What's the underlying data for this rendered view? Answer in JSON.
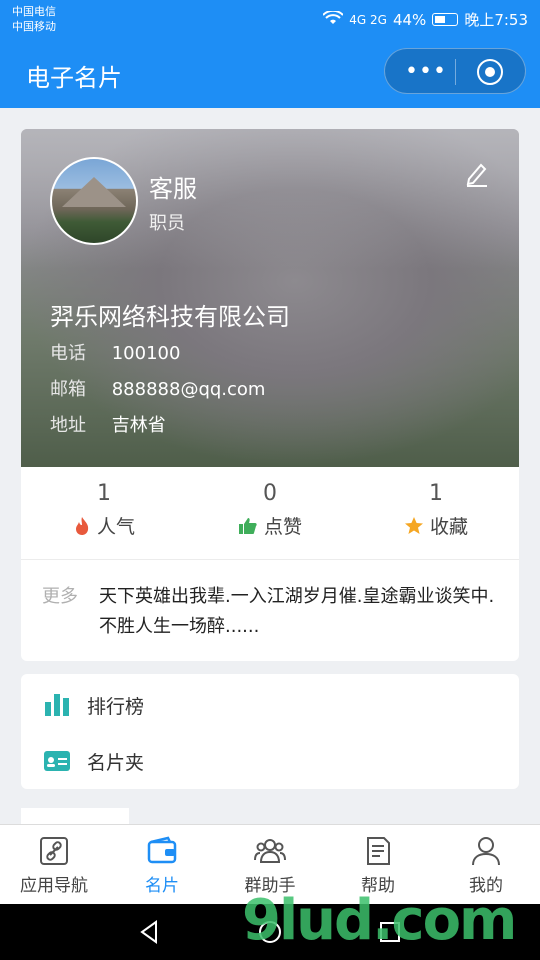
{
  "status": {
    "carrier1": "中国电信",
    "carrier2": "中国移动",
    "signal": "4G 2G",
    "battery": "44%",
    "time": "晚上7:53"
  },
  "nav": {
    "title": "电子名片",
    "more": "•••"
  },
  "profile": {
    "name": "客服",
    "position": "职员",
    "company": "羿乐网络科技有限公司",
    "phone_label": "电话",
    "phone": "100100",
    "email_label": "邮箱",
    "email": "888888@qq.com",
    "address_label": "地址",
    "address": "吉林省"
  },
  "stats": [
    {
      "value": "1",
      "label": "人气",
      "icon": "fire-icon",
      "color": "#e8593c"
    },
    {
      "value": "0",
      "label": "点赞",
      "icon": "thumbs-up-icon",
      "color": "#3fae5a"
    },
    {
      "value": "1",
      "label": "收藏",
      "icon": "star-icon",
      "color": "#f5a623"
    }
  ],
  "more": {
    "label": "更多",
    "text": "天下英雄出我辈.一入江湖岁月催.皇途霸业谈笑中.不胜人生一场醉......"
  },
  "menu": [
    {
      "label": "排行榜",
      "icon": "bar-chart-icon"
    },
    {
      "label": "名片夹",
      "icon": "card-holder-icon"
    }
  ],
  "tabs": [
    {
      "label": "应用导航",
      "icon": "link-icon",
      "active": false
    },
    {
      "label": "名片",
      "icon": "wallet-icon",
      "active": true
    },
    {
      "label": "群助手",
      "icon": "group-icon",
      "active": false
    },
    {
      "label": "帮助",
      "icon": "document-icon",
      "active": false
    },
    {
      "label": "我的",
      "icon": "user-icon",
      "active": false
    }
  ],
  "colors": {
    "primary": "#1e8ef5",
    "accent_teal": "#2bb3b0"
  },
  "watermark": "9lud.com"
}
